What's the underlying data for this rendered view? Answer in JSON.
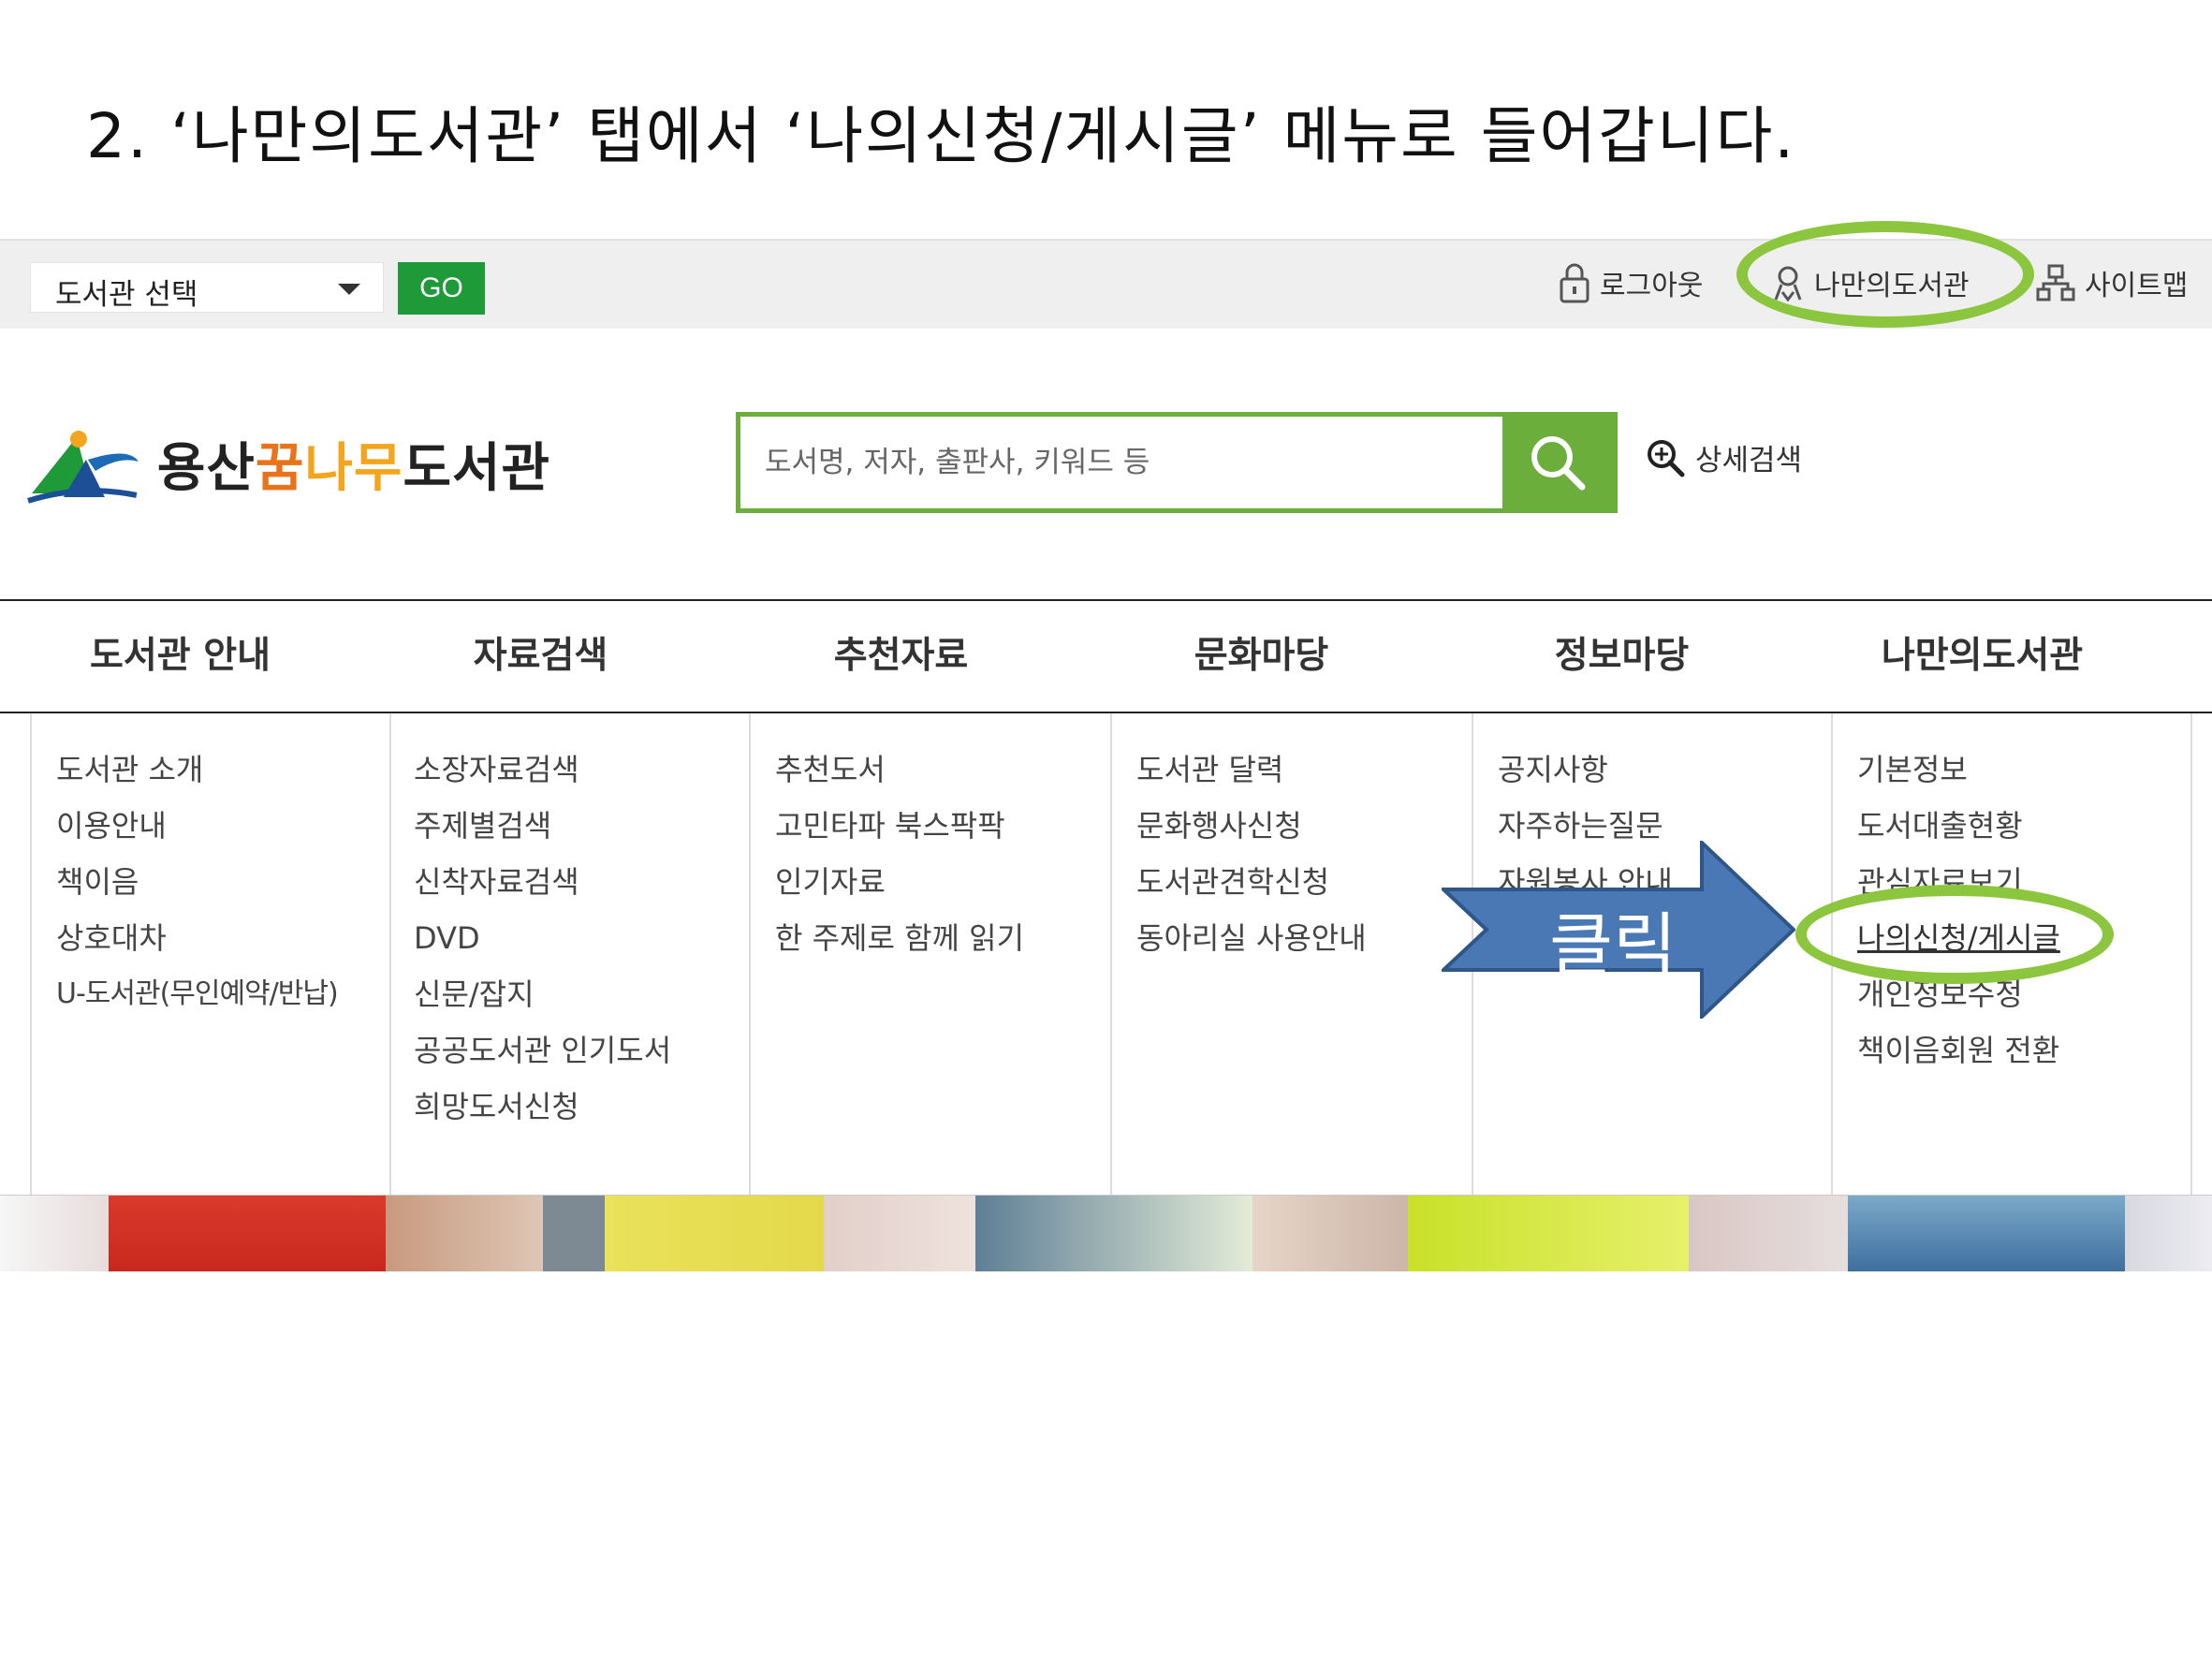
{
  "heading": "2. ‘나만의도서관’ 탭에서 ‘나의신청/게시글’ 메뉴로 들어갑니다.",
  "topbar": {
    "library_select": "도서관 선택",
    "go_label": "GO",
    "logout_label": "로그아웃",
    "my_library_label": "나만의도서관",
    "sitemap_label": "사이트맵"
  },
  "header": {
    "logo_parts": [
      "용산",
      "꿈",
      "나무",
      "도서관"
    ],
    "search_placeholder": "도서명, 저자, 출판사, 키워드 등",
    "advanced_search_label": "상세검색"
  },
  "nav": [
    "도서관 안내",
    "자료검색",
    "추천자료",
    "문화마당",
    "정보마당",
    "나만의도서관"
  ],
  "menu": [
    [
      "도서관 소개",
      "이용안내",
      "책이음",
      "상호대차",
      "U-도서관(무인예약/반납)"
    ],
    [
      "소장자료검색",
      "주제별검색",
      "신착자료검색",
      "DVD",
      "신문/잡지",
      "공공도서관 인기도서",
      "희망도서신청"
    ],
    [
      "추천도서",
      "고민타파 북스팍팍",
      "인기자료",
      "한 주제로 함께 읽기"
    ],
    [
      "도서관 달력",
      "문화행사신청",
      "도서관견학신청",
      "동아리실 사용안내"
    ],
    [
      "공지사항",
      "자주하는질문",
      "자원봉사 안내"
    ],
    [
      "기본정보",
      "도서대출현황",
      "관심자료보기",
      "나의신청/게시글",
      "개인정보수정",
      "책이음회원 전환"
    ]
  ],
  "active_menu_item": "나의신청/게시글",
  "annotation": {
    "arrow_label": "클릭",
    "highlight_color": "#8cc63f",
    "arrow_color": "#4a78b5"
  },
  "colors": {
    "go_button": "#1e9a39",
    "search_accent": "#6cae3b"
  }
}
